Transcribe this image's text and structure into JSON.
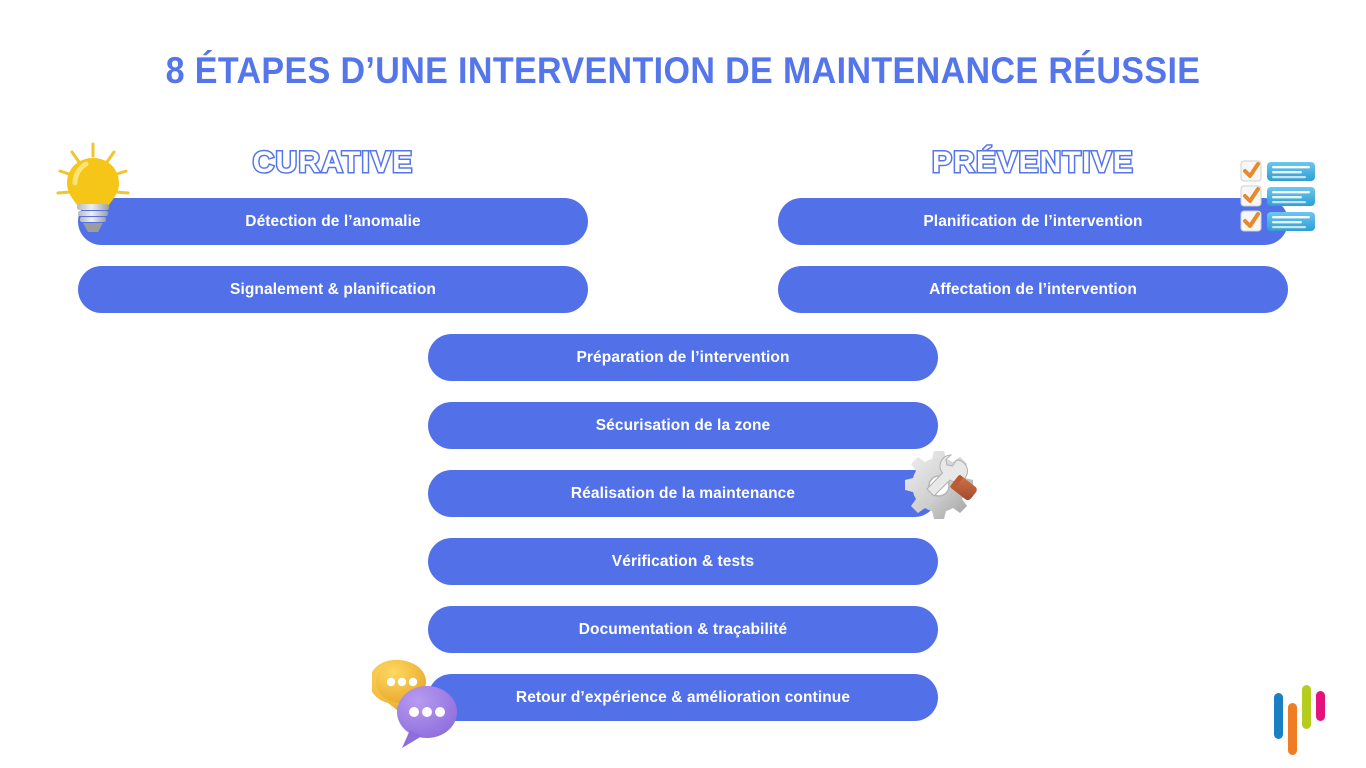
{
  "slide": {
    "title": "8 ÉTAPES D’UNE INTERVENTION DE MAINTENANCE RÉUSSIE",
    "background_color": "#ffffff",
    "accent_color": "#5271e8",
    "title_color": "#5575ea"
  },
  "columns": {
    "left": {
      "header": "CURATIVE",
      "steps": [
        "Détection de l’anomalie",
        "Signalement & planification"
      ]
    },
    "right": {
      "header": "PRÉVENTIVE",
      "steps": [
        "Planification de l’intervention",
        "Affectation de l’intervention"
      ]
    }
  },
  "shared_steps": [
    "Préparation de l’intervention",
    "Sécurisation de la zone",
    "Réalisation de la maintenance",
    "Vérification & tests",
    "Documentation & traçabilité",
    "Retour d’expérience & amélioration continue"
  ],
  "icons": {
    "lightbulb": "lightbulb-icon",
    "checklist": "checklist-icon",
    "gear_wrench": "gear-wrench-icon",
    "speech_bubbles": "speech-bubbles-icon",
    "logo": "brand-logo-bars-icon"
  },
  "logo_colors": [
    "#1b7fc4",
    "#ee7d23",
    "#b5cd1f",
    "#e5127d"
  ]
}
